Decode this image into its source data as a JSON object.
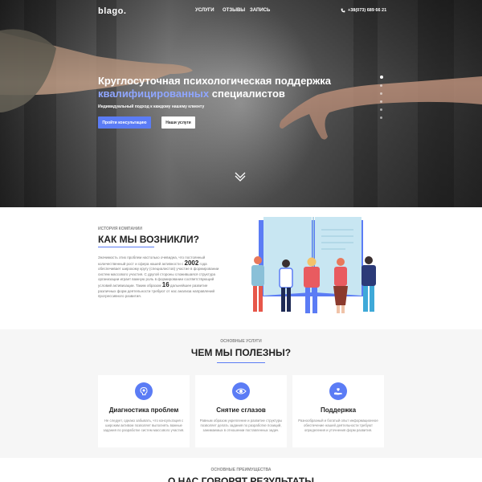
{
  "header": {
    "logo": "blago.",
    "nav": [
      "УСЛУГИ",
      "ОТЗЫВЫ",
      "ЗАПИСЬ"
    ],
    "phone": "+38(073) 689 66 21",
    "phone_icon": "phone-icon"
  },
  "hero": {
    "title_line1": "Круглосуточная психологическая поддержка",
    "title_accent": "квалифицированных",
    "title_rest": " специалистов",
    "subtitle": "Индивидуальный подход к каждому нашему клиенту",
    "primary_button": "Пройти консультацию",
    "secondary_button": "Наши услуги",
    "slide_dots": 6,
    "active_slide": 1
  },
  "about": {
    "eyebrow": "ИСТОРИЯ КОМПАНИИ",
    "title": "КАК МЫ ВОЗНИКЛИ?",
    "text_1": "Значимость этих проблем настолько очевидна, что постоянный количественный рост и сфера нашей активности с ",
    "year": "2002",
    "text_2": " года обеспечивает широкому кругу (специалистов) участие в формировании систем массового участия. С другой стороны сложившаяся структура организации играет важную роль в формировании соответствующий условий активизации. Таким образом ",
    "number": "16",
    "text_3": " дальнейшее развитие различных форм деятельности требуют от нас анализа направлений прогрессивного развития."
  },
  "services": {
    "eyebrow": "ОСНОВНЫЕ УСЛУГИ",
    "title": "ЧЕМ МЫ ПОЛЕЗНЫ?",
    "cards": [
      {
        "icon": "brain-icon",
        "title": "Диагностика проблем",
        "text": "Не следует, однако забывать, что консультация с широким активом позволяет выполнять важные задания по разработке систем массового участия."
      },
      {
        "icon": "eye-icon",
        "title": "Снятие сглазов",
        "text": "Равным образом укрепление и развитие структуры позволяет делать задания по разработке позиций, занимаемых в отношении поставленных задач."
      },
      {
        "icon": "support-icon",
        "title": "Поддержка",
        "text": "Разнообразный и богатый опыт информационное обеспечение нашей деятельности требуют определения и уточнения форм развития."
      }
    ]
  },
  "advantages": {
    "eyebrow": "ОСНОВНЫЕ ПРЕИМУЩЕСТВА",
    "title": "О НАС ГОВОРЯТ РЕЗУЛЬТАТЫ"
  },
  "colors": {
    "accent": "#5b7cf5",
    "accent_light": "#8fa6ff",
    "dark_text": "#222222",
    "muted_text": "#888888"
  }
}
